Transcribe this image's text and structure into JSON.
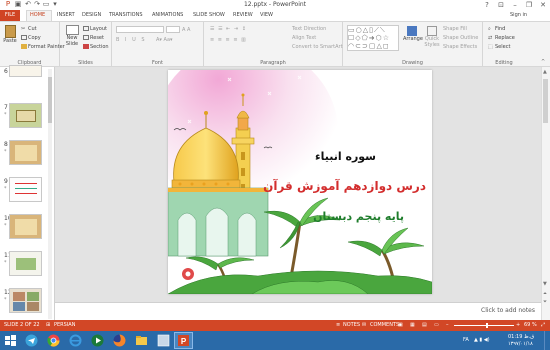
{
  "window": {
    "title": "12.pptx - PowerPoint",
    "help": "?"
  },
  "tabs": [
    "FILE",
    "HOME",
    "INSERT",
    "DESIGN",
    "TRANSITIONS",
    "ANIMATIONS",
    "SLIDE SHOW",
    "REVIEW",
    "VIEW"
  ],
  "user": "Sign in",
  "ribbon": {
    "clipboard": {
      "label": "Clipboard",
      "paste": "Paste",
      "cut": "Cut",
      "copy": "Copy",
      "format_painter": "Format Painter"
    },
    "slides": {
      "label": "Slides",
      "new_slide_1": "New",
      "new_slide_2": "Slide",
      "layout": "Layout",
      "reset": "Reset",
      "section": "Section"
    },
    "font": {
      "label": "Font"
    },
    "paragraph": {
      "label": "Paragraph",
      "text_direction": "Text Direction",
      "align_text": "Align Text",
      "convert_smartart": "Convert to SmartArt"
    },
    "drawing": {
      "label": "Drawing",
      "arrange": "Arrange",
      "quick_styles_1": "Quick",
      "quick_styles_2": "Styles",
      "shape_fill": "Shape Fill",
      "shape_outline": "Shape Outline",
      "shape_effects": "Shape Effects"
    },
    "editing": {
      "label": "Editing",
      "find": "Find",
      "replace": "Replace",
      "select": "Select"
    }
  },
  "slides_panel": {
    "numbers": [
      "6",
      "7",
      "8",
      "9",
      "10",
      "11",
      "12"
    ]
  },
  "slide": {
    "line1": "سوره انبیاء",
    "line2": "درس دوازدهم آموزش قرآن",
    "line3": "پایه پنجم دبستان"
  },
  "notes_placeholder": "Click to add notes",
  "status": {
    "slide_of": "SLIDE 2 OF 22",
    "language": "PERSIAN",
    "notes": "NOTES",
    "comments": "COMMENTS",
    "zoom": "69 %"
  },
  "taskbar": {
    "lang": "FA",
    "time": "01:19 ق.ظ",
    "date": "۱۳۹۷/۰۱/۱۸"
  },
  "colors": {
    "accent": "#d24726",
    "slide_title1": "#101010",
    "slide_title2": "#d32d2d",
    "slide_title3": "#1f7d2c",
    "taskbar": "#2a6aa8"
  }
}
